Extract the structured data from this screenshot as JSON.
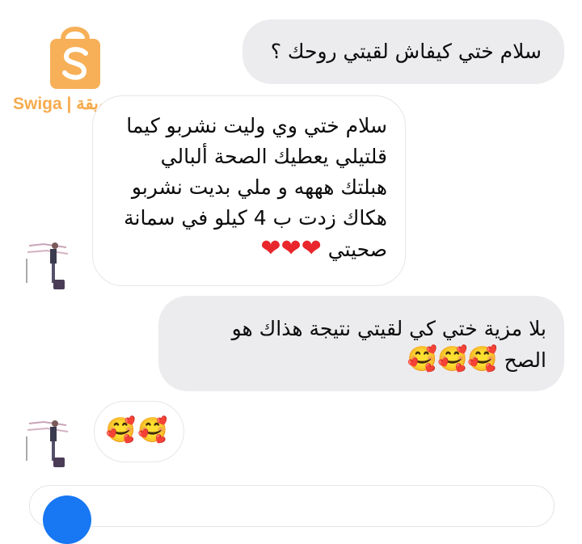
{
  "watermark": {
    "brand_text": "Swiga | سويقة",
    "brand_color": "#f6a23a"
  },
  "messages": [
    {
      "direction": "sent",
      "lines": [
        "سلام ختي كيفاش لقيتي روحك ؟"
      ]
    },
    {
      "direction": "received",
      "lines": [
        "سلام ختي وي وليت نشربو كيما",
        "قلتيلي يعطيك الصحة ألبالي",
        "هبلتك هههه و ملي بديت نشربو",
        "هكاك زدت ب 4 كيلو في سمانة",
        "صحيتي"
      ],
      "reaction": "❤❤❤"
    },
    {
      "direction": "sent",
      "lines": [
        "بلا مزية ختي كي لقيتي نتيجة هذاك هو",
        "الصح"
      ],
      "reaction": "🥰🥰🥰"
    },
    {
      "direction": "received",
      "lines": [],
      "reaction": "🥰🥰"
    }
  ],
  "composer": {
    "accent_color": "#1877f2"
  }
}
